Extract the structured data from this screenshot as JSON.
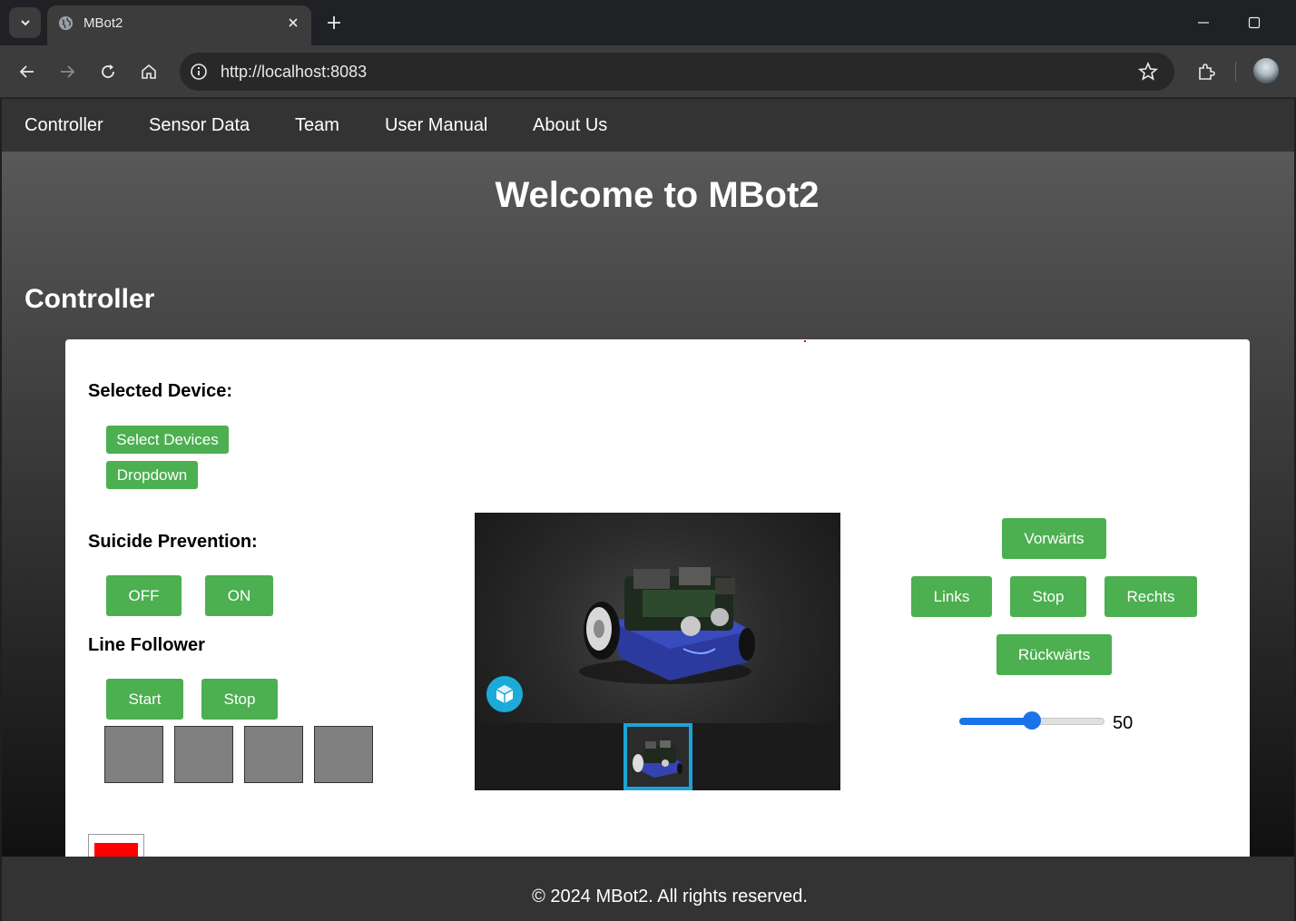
{
  "browser": {
    "tab_title": "MBot2",
    "url": "http://localhost:8083"
  },
  "nav": {
    "items": [
      "Controller",
      "Sensor Data",
      "Team",
      "User Manual",
      "About Us"
    ]
  },
  "header": {
    "welcome": "Welcome to MBot2"
  },
  "main": {
    "section_title": "Controller",
    "selected_device_label": "Selected Device:",
    "select_devices_button": "Select Devices",
    "dropdown_button": "Dropdown",
    "suicide_prevention_label": "Suicide Prevention:",
    "off_button": "OFF",
    "on_button": "ON",
    "line_follower_label": "Line Follower",
    "start_button": "Start",
    "stop_button": "Stop",
    "sensor_color": "#808080",
    "indicator_color": "#ff0000"
  },
  "drive": {
    "forward": "Vorwärts",
    "left": "Links",
    "stop": "Stop",
    "right": "Rechts",
    "backward": "Rückwärts",
    "speed_value": 50,
    "speed_min": 0,
    "speed_max": 100
  },
  "colors": {
    "button_green": "#4caf50",
    "slider_blue": "#1a73e8",
    "viewer_accent": "#1ca3d8"
  },
  "footer": {
    "text": "© 2024 MBot2. All rights reserved."
  }
}
